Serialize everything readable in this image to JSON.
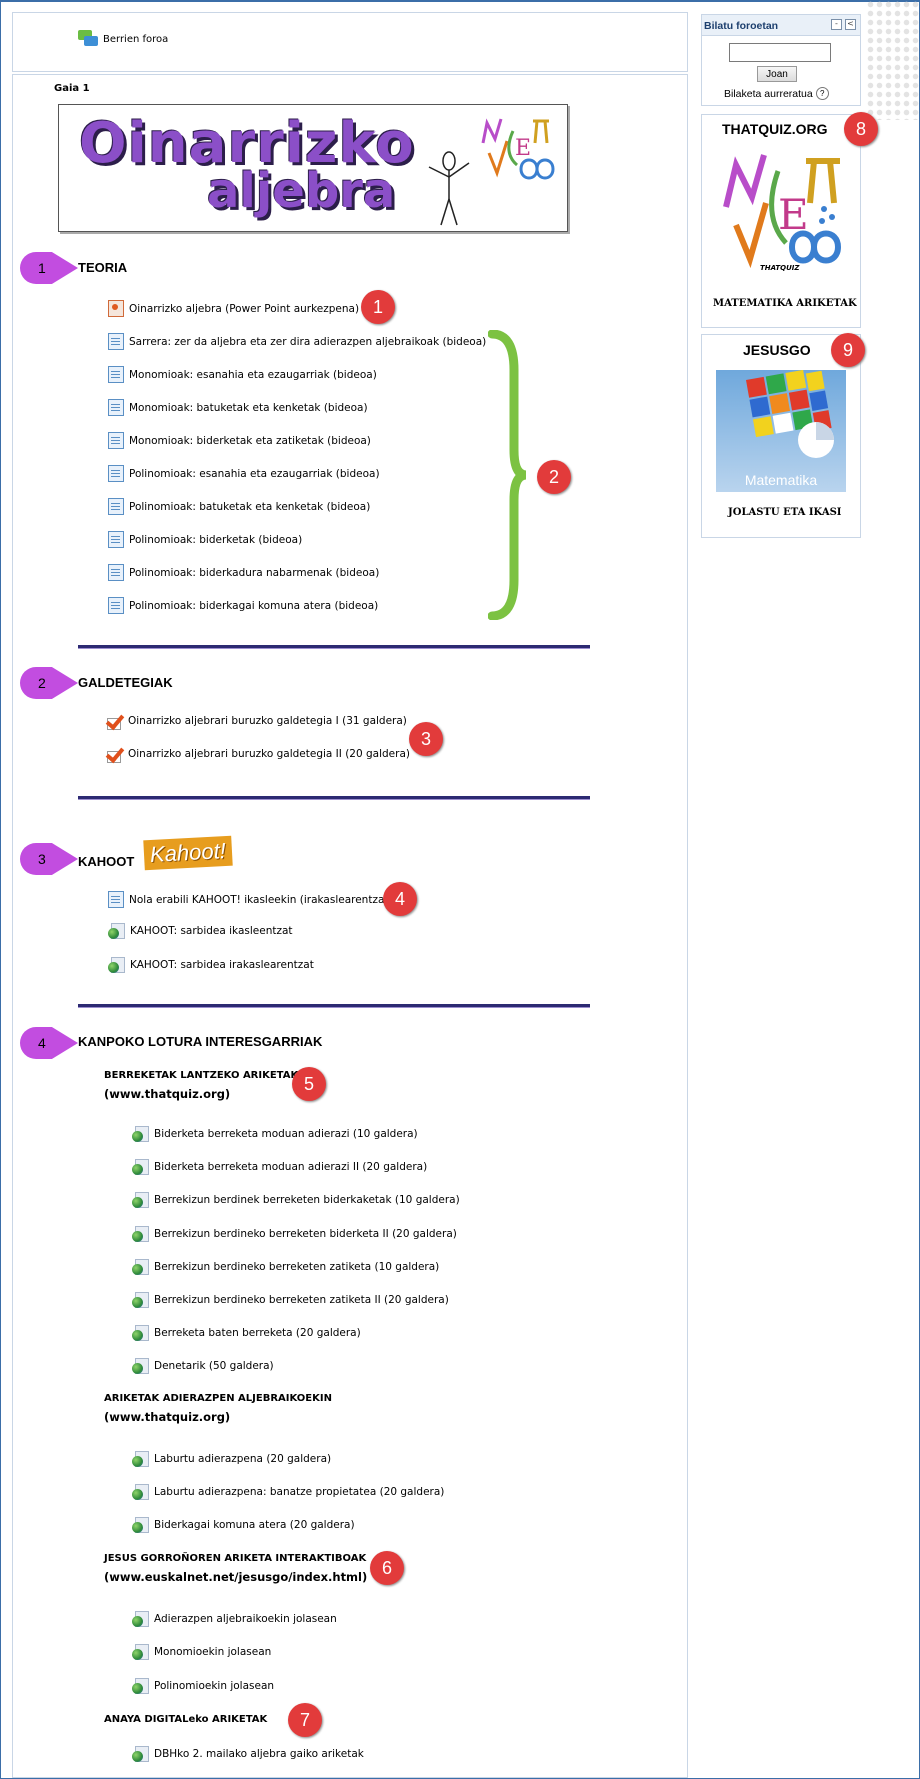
{
  "header": {
    "forum_label": "Berrien foroa"
  },
  "topic": {
    "label": "Gaia 1",
    "banner_line1": "Oinarrizko",
    "banner_line2": "aljebra"
  },
  "sections": [
    {
      "num": "1",
      "title": "TEORIA"
    },
    {
      "num": "2",
      "title": "GALDETEGIAK"
    },
    {
      "num": "3",
      "title": "KAHOOT",
      "logo": "Kahoot!"
    },
    {
      "num": "4",
      "title": "KANPOKO LOTURA INTERESGARRIAK"
    }
  ],
  "teoria_items": [
    "Oinarrizko aljebra (Power Point aurkezpena)",
    "Sarrera: zer da aljebra eta zer dira adierazpen aljebraikoak (bideoa)",
    "Monomioak: esanahia eta ezaugarriak (bideoa)",
    "Monomioak: batuketak eta kenketak (bideoa)",
    "Monomioak: biderketak eta zatiketak (bideoa)",
    "Polinomioak: esanahia eta ezaugarriak (bideoa)",
    "Polinomioak: batuketak eta kenketak (bideoa)",
    "Polinomioak: biderketak (bideoa)",
    "Polinomioak: biderkadura nabarmenak (bideoa)",
    "Polinomioak: biderkagai komuna atera (bideoa)"
  ],
  "galdetegiak_items": [
    "Oinarrizko aljebrari buruzko galdetegia I (31 galdera)",
    "Oinarrizko aljebrari buruzko galdetegia II (20 galdera)"
  ],
  "kahoot_items": [
    "Nola erabili KAHOOT! ikasleekin (irakaslearentzat)",
    "KAHOOT: sarbidea ikasleentzat",
    "KAHOOT: sarbidea irakaslearentzat"
  ],
  "sub1": {
    "title": "BERREKETAK LANTZEKO ARIKETAK",
    "url": "(www.thatquiz.org)",
    "items": [
      "Biderketa berreketa moduan adierazi (10 galdera)",
      "Biderketa berreketa moduan adierazi II (20 galdera)",
      "Berrekizun berdinek berreketen biderkaketak (10 galdera)",
      "Berrekizun berdineko berreketen biderketa II (20 galdera)",
      "Berrekizun berdineko berreketen zatiketa (10 galdera)",
      "Berrekizun berdineko berreketen zatiketa II (20 galdera)",
      "Berreketa baten berreketa (20 galdera)",
      "Denetarik (50 galdera)"
    ]
  },
  "sub2": {
    "title": "ARIKETAK ADIERAZPEN ALJEBRAIKOEKIN",
    "url": "(www.thatquiz.org)",
    "items": [
      "Laburtu adierazpena (20 galdera)",
      "Laburtu adierazpena: banatze propietatea (20 galdera)",
      "Biderkagai komuna atera (20 galdera)"
    ]
  },
  "sub3": {
    "title": "JESUS GORROÑOREN ARIKETA INTERAKTIBOAK",
    "url": "(www.euskalnet.net/jesusgo/index.html)",
    "items": [
      "Adierazpen aljebraikoekin jolasean",
      "Monomioekin jolasean",
      "Polinomioekin jolasean"
    ]
  },
  "sub4": {
    "title": "ANAYA DIGITALeko ARIKETAK",
    "items": [
      "DBHko 2. mailako aljebra gaiko ariketak"
    ]
  },
  "badges": [
    "1",
    "2",
    "3",
    "4",
    "5",
    "6",
    "7",
    "8",
    "9"
  ],
  "sidebar": {
    "search": {
      "title": "Bilatu foroetan",
      "button": "Joan",
      "advanced": "Bilaketa aurreratua",
      "help": "?",
      "value": ""
    },
    "thatquiz": {
      "title": "THATQUIZ.ORG",
      "caption": "MATEMATIKA ARIKETAK",
      "logo_text": "THATQUIZ"
    },
    "jesusgo": {
      "title": "JESUSGO",
      "caption": "JOLASTU ETA IKASI",
      "image_text": "Matematika"
    }
  },
  "colors": {
    "section_arrow": "#c24de0",
    "badge": "#e23b3b",
    "bracket": "#7cc242",
    "divider": "#2c2a72"
  }
}
